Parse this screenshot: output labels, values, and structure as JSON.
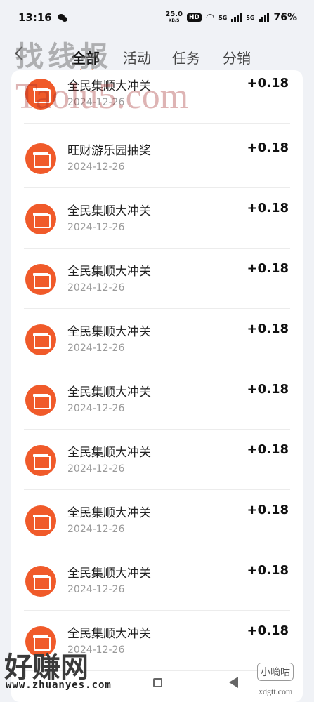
{
  "status_bar": {
    "time": "13:16",
    "net_speed": "25.0",
    "net_unit": "KB/S",
    "hd": "HD",
    "network_1": "5G",
    "network_2": "5G",
    "battery": "76%"
  },
  "tabs": {
    "all": "全部",
    "activity": "活动",
    "task": "任务",
    "distribution": "分销"
  },
  "records": [
    {
      "title": "全民集顺大冲关",
      "date": "2024-12-26",
      "amount": "+0.18"
    },
    {
      "title": "旺财游乐园抽奖",
      "date": "2024-12-26",
      "amount": "+0.18"
    },
    {
      "title": "全民集顺大冲关",
      "date": "2024-12-26",
      "amount": "+0.18"
    },
    {
      "title": "全民集顺大冲关",
      "date": "2024-12-26",
      "amount": "+0.18"
    },
    {
      "title": "全民集顺大冲关",
      "date": "2024-12-26",
      "amount": "+0.18"
    },
    {
      "title": "全民集顺大冲关",
      "date": "2024-12-26",
      "amount": "+0.18"
    },
    {
      "title": "全民集顺大冲关",
      "date": "2024-12-26",
      "amount": "+0.18"
    },
    {
      "title": "全民集顺大冲关",
      "date": "2024-12-26",
      "amount": "+0.18"
    },
    {
      "title": "全民集顺大冲关",
      "date": "2024-12-26",
      "amount": "+0.18"
    },
    {
      "title": "全民集顺大冲关",
      "date": "2024-12-26",
      "amount": "+0.18"
    }
  ],
  "watermarks": {
    "top": "找线报",
    "mid": "Taolu5.com",
    "bottom_left": "好赚网",
    "bottom_left_url": "www.zhuanyes.com",
    "bottom_right": "小嘀咕",
    "bottom_right_url": "xdgtt.com"
  },
  "colors": {
    "accent": "#f26a2e",
    "icon_bg": "#f05a2a"
  }
}
